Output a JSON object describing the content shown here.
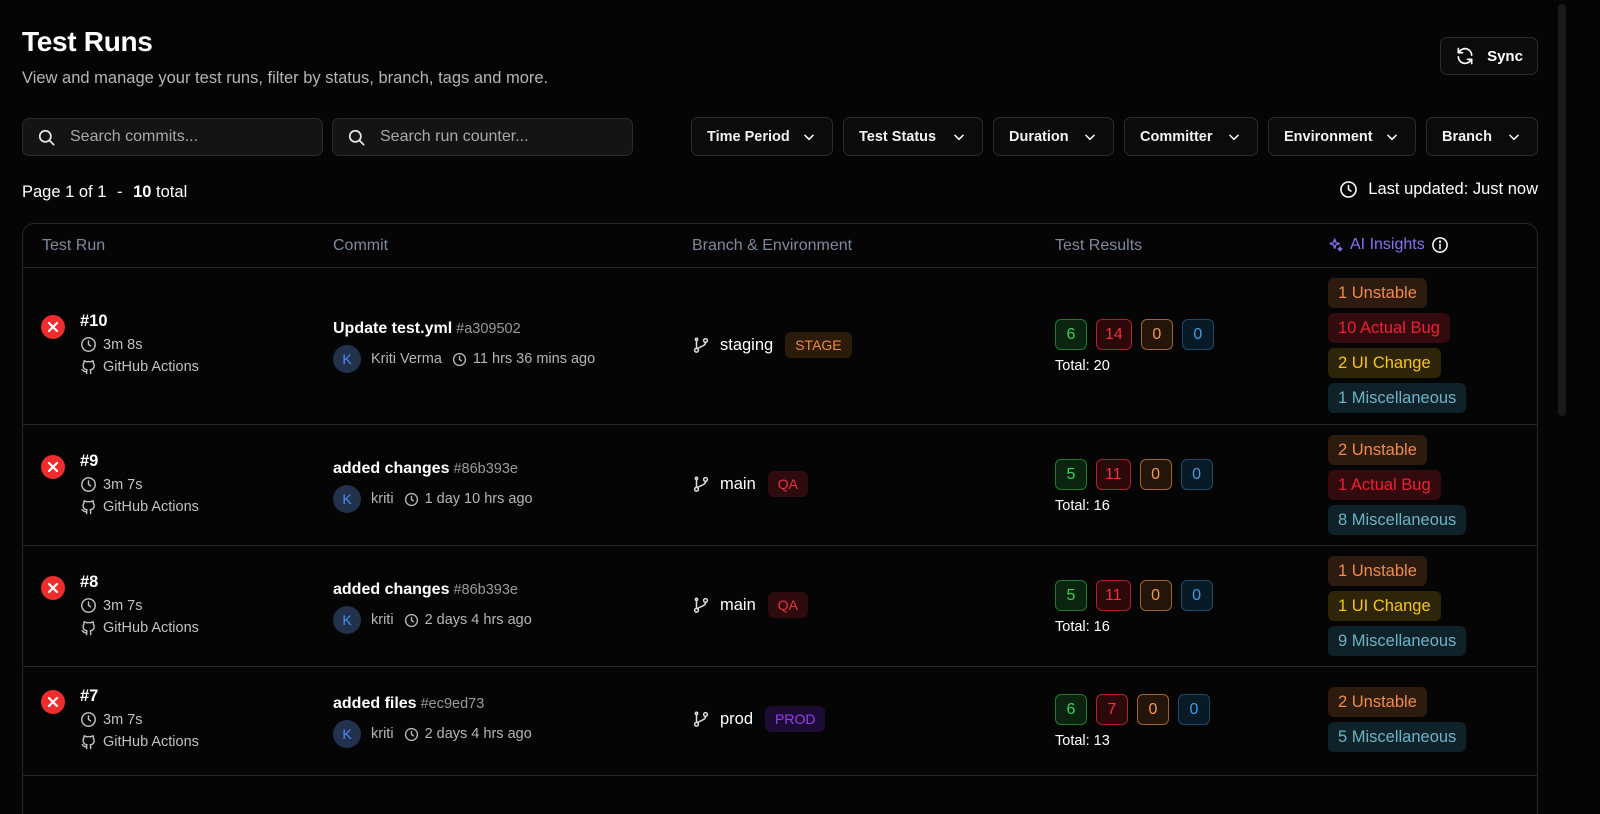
{
  "header": {
    "title": "Test Runs",
    "subtitle": "View and manage your test runs, filter by status, branch, tags and more.",
    "sync_label": "Sync"
  },
  "search": {
    "commits_placeholder": "Search commits...",
    "run_counter_placeholder": "Search run counter..."
  },
  "filters": [
    "Time Period",
    "Test Status",
    "Duration",
    "Committer",
    "Environment",
    "Branch"
  ],
  "pagination": {
    "page_text": "Page 1 of 1",
    "separator": "-",
    "total_count": "10",
    "total_label": "total"
  },
  "last_updated": "Last updated: Just now",
  "table": {
    "columns": [
      "Test Run",
      "Commit",
      "Branch & Environment",
      "Test Results",
      "AI Insights"
    ],
    "rows": [
      {
        "run": "#10",
        "duration": "3m 8s",
        "source": "GitHub Actions",
        "commit_message": "Update test.yml",
        "commit_sha": "#a309502",
        "author_initial": "K",
        "author": "Kriti Verma",
        "time_ago": "11 hrs 36 mins ago",
        "branch": "staging",
        "environment": "STAGE",
        "passed": "6",
        "failed": "14",
        "flaky": "0",
        "skipped": "0",
        "total": "Total: 20",
        "insights": [
          "1 Unstable",
          "10 Actual Bug",
          "2 UI Change",
          "1 Miscellaneous"
        ]
      },
      {
        "run": "#9",
        "duration": "3m 7s",
        "source": "GitHub Actions",
        "commit_message": "added changes",
        "commit_sha": "#86b393e",
        "author_initial": "K",
        "author": "kriti",
        "time_ago": "1 day 10 hrs ago",
        "branch": "main",
        "environment": "QA",
        "passed": "5",
        "failed": "11",
        "flaky": "0",
        "skipped": "0",
        "total": "Total: 16",
        "insights": [
          "2 Unstable",
          "1 Actual Bug",
          "8 Miscellaneous"
        ]
      },
      {
        "run": "#8",
        "duration": "3m 7s",
        "source": "GitHub Actions",
        "commit_message": "added changes",
        "commit_sha": "#86b393e",
        "author_initial": "K",
        "author": "kriti",
        "time_ago": "2 days 4 hrs ago",
        "branch": "main",
        "environment": "QA",
        "passed": "5",
        "failed": "11",
        "flaky": "0",
        "skipped": "0",
        "total": "Total: 16",
        "insights": [
          "1 Unstable",
          "1 UI Change",
          "9 Miscellaneous"
        ]
      },
      {
        "run": "#7",
        "duration": "3m 7s",
        "source": "GitHub Actions",
        "commit_message": "added files",
        "commit_sha": "#ec9ed73",
        "author_initial": "K",
        "author": "kriti",
        "time_ago": "2 days 4 hrs ago",
        "branch": "prod",
        "environment": "PROD",
        "passed": "6",
        "failed": "7",
        "flaky": "0",
        "skipped": "0",
        "total": "Total: 13",
        "insights": [
          "2 Unstable",
          "5 Miscellaneous"
        ]
      }
    ]
  },
  "colors": {
    "background": "#050505",
    "fail_status": "#ef2d2d",
    "ai_accent": "#8a6ff5",
    "passed": "#3fd05a",
    "failed": "#f0323f",
    "flaky": "#f39c4a",
    "skipped": "#3b9ee8"
  }
}
